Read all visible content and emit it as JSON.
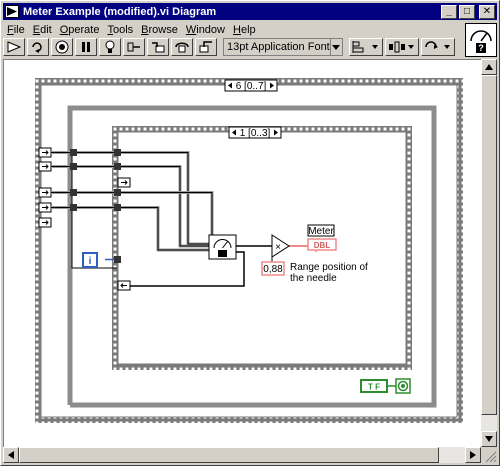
{
  "window": {
    "title": "Meter Example (modified).vi Diagram",
    "minimize": "_",
    "maximize": "□",
    "close": "✕"
  },
  "menu": {
    "items": [
      {
        "underline": "F",
        "rest": "ile"
      },
      {
        "underline": "E",
        "rest": "dit"
      },
      {
        "underline": "O",
        "rest": "perate"
      },
      {
        "underline": "T",
        "rest": "ools"
      },
      {
        "underline": "B",
        "rest": "rowse"
      },
      {
        "underline": "W",
        "rest": "indow"
      },
      {
        "underline": "H",
        "rest": "elp"
      }
    ]
  },
  "toolbar": {
    "font_value": "13pt Application Font",
    "icons": [
      "run-arrow-icon",
      "run-continuous-icon",
      "abort-icon",
      "pause-icon",
      "highlight-execution-icon",
      "retain-wire-values-icon",
      "step-into-icon",
      "step-over-icon",
      "step-out-icon"
    ],
    "dropdowns": [
      "align-objects-icon",
      "distribute-objects-icon",
      "reorder-icon"
    ]
  },
  "help": {
    "symbol": "?"
  },
  "diagram": {
    "outer_sequence_label": "6 [0..7]",
    "inner_sequence_label": "1 [0..3]",
    "iteration_terminal": "i",
    "constant_value": "0,88",
    "range_caption_line1": "Range position of",
    "range_caption_line2": "the needle",
    "indicator_label": "Meter",
    "indicator_type": "DBL",
    "multiply_symbol": "×",
    "boolean_constant": "T F"
  }
}
